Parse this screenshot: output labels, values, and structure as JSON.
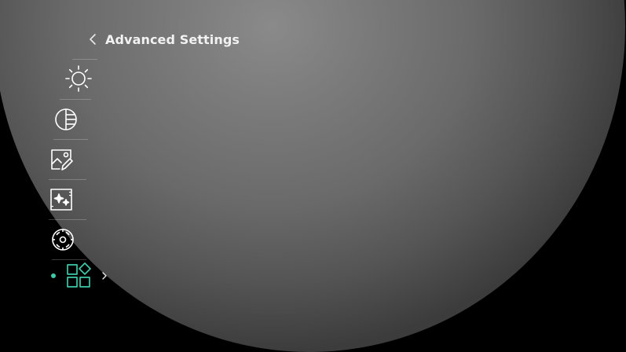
{
  "header": {
    "back_icon": "chevron-left-icon",
    "title": "Advanced Settings"
  },
  "menu": {
    "items": [
      {
        "id": "brightness",
        "icon": "sun-icon",
        "active": false
      },
      {
        "id": "contrast",
        "icon": "contrast-icon",
        "active": false
      },
      {
        "id": "image-edit",
        "icon": "image-edit-icon",
        "active": false
      },
      {
        "id": "image-enhance",
        "icon": "image-sparkle-icon",
        "active": false
      },
      {
        "id": "calibration",
        "icon": "target-calibration-icon",
        "active": false
      },
      {
        "id": "function-settings",
        "icon": "apps-grid-icon",
        "active": true
      }
    ]
  },
  "colors": {
    "accent": "#3ec9a7",
    "icon": "#ffffff",
    "background": "#000000"
  }
}
